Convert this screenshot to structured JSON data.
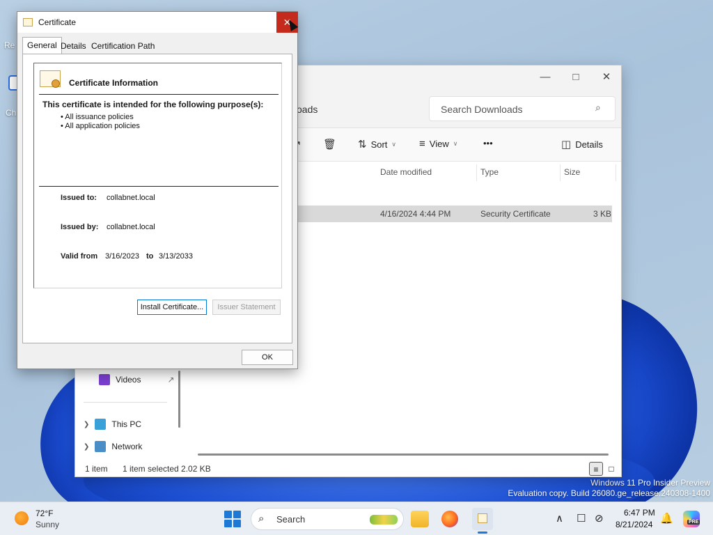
{
  "desktop": {
    "icon_labels": [
      "Re",
      "Ch"
    ],
    "watermark_line1": "Windows 11 Pro Insider Preview",
    "watermark_line2": "Evaluation copy. Build 26080.ge_release.240308-1400"
  },
  "explorer": {
    "path_fragment": "oads",
    "search_placeholder": "Search Downloads",
    "toolbar": {
      "sort_label": "Sort",
      "view_label": "View",
      "more_label": "•••",
      "details_label": "Details"
    },
    "columns": [
      "Date modified",
      "Type",
      "Size"
    ],
    "row": {
      "date": "4/16/2024 4:44 PM",
      "type": "Security Certificate",
      "size": "3 KB"
    },
    "nav": {
      "videos": "Videos",
      "this_pc": "This PC",
      "network": "Network"
    },
    "status": {
      "items": "1 item",
      "selected": "1 item selected  2.02 KB"
    }
  },
  "certificate": {
    "title": "Certificate",
    "tabs": [
      "General",
      "Details",
      "Certification Path"
    ],
    "info_title": "Certificate Information",
    "purpose_heading": "This certificate is intended for the following purpose(s):",
    "purposes": [
      "• All issuance policies",
      "• All application policies"
    ],
    "issued_to_label": "Issued to:",
    "issued_to": "collabnet.local",
    "issued_by_label": "Issued by:",
    "issued_by": "collabnet.local",
    "valid_from_label": "Valid from",
    "valid_from": "3/16/2023",
    "to_label": "to",
    "valid_to": "3/13/2033",
    "install_button": "Install Certificate...",
    "issuer_button": "Issuer Statement",
    "ok_button": "OK"
  },
  "taskbar": {
    "temperature": "72°F",
    "condition": "Sunny",
    "search_label": "Search",
    "time": "6:47 PM",
    "date": "8/21/2024",
    "copilot_badge": "PRE"
  }
}
